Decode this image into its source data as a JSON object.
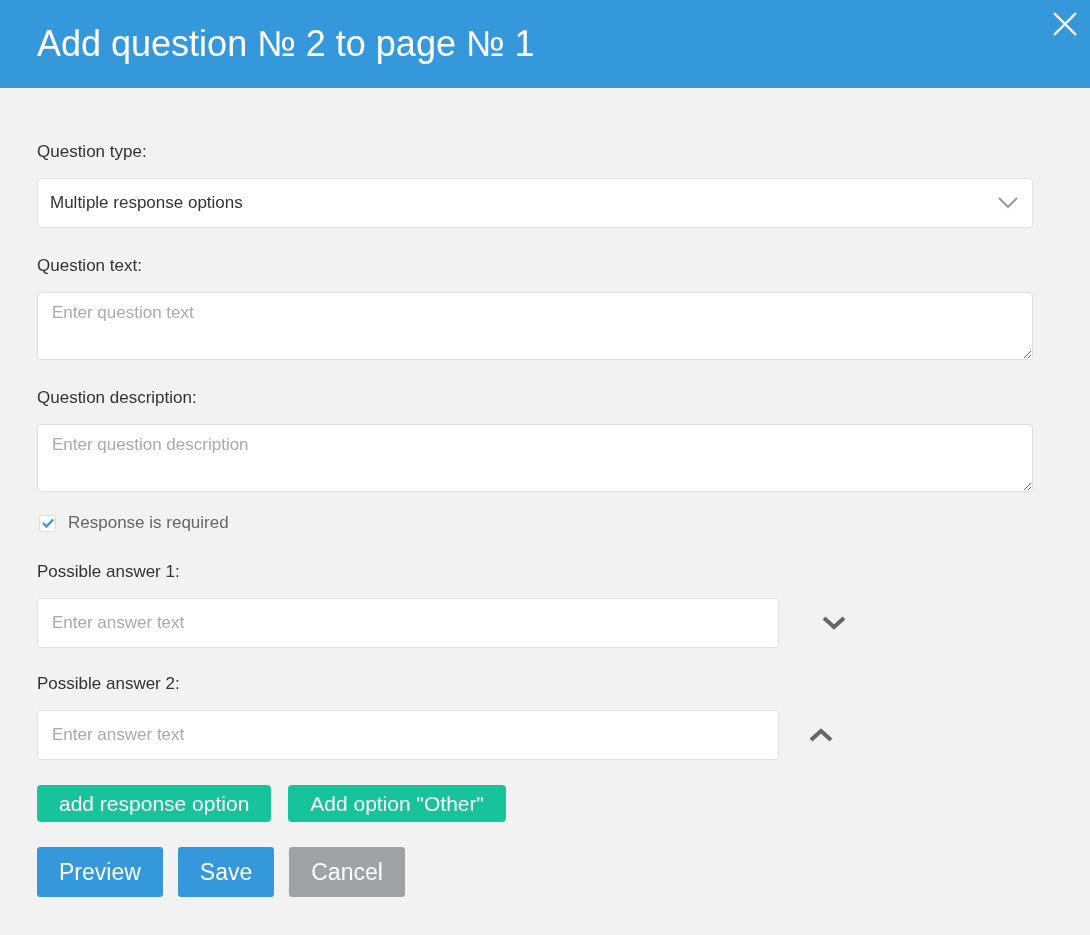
{
  "dialog": {
    "title": "Add question № 2 to page № 1"
  },
  "question_type": {
    "label": "Question type:",
    "value": "Multiple response options"
  },
  "question_text": {
    "label": "Question text:",
    "placeholder": "Enter question text"
  },
  "question_description": {
    "label": "Question description:",
    "placeholder": "Enter question description"
  },
  "required": {
    "label": "Response is required",
    "checked": true
  },
  "answers": [
    {
      "label": "Possible answer 1:",
      "placeholder": "Enter answer text",
      "kind": "down"
    },
    {
      "label": "Possible answer 2:",
      "placeholder": "Enter answer text",
      "kind": "up"
    }
  ],
  "option_buttons": [
    "add response option",
    "Add option \"Other\""
  ],
  "actions": [
    {
      "label": "Preview",
      "kind": "primary"
    },
    {
      "label": "Save",
      "kind": "primary"
    },
    {
      "label": "Cancel",
      "kind": "secondary"
    }
  ]
}
